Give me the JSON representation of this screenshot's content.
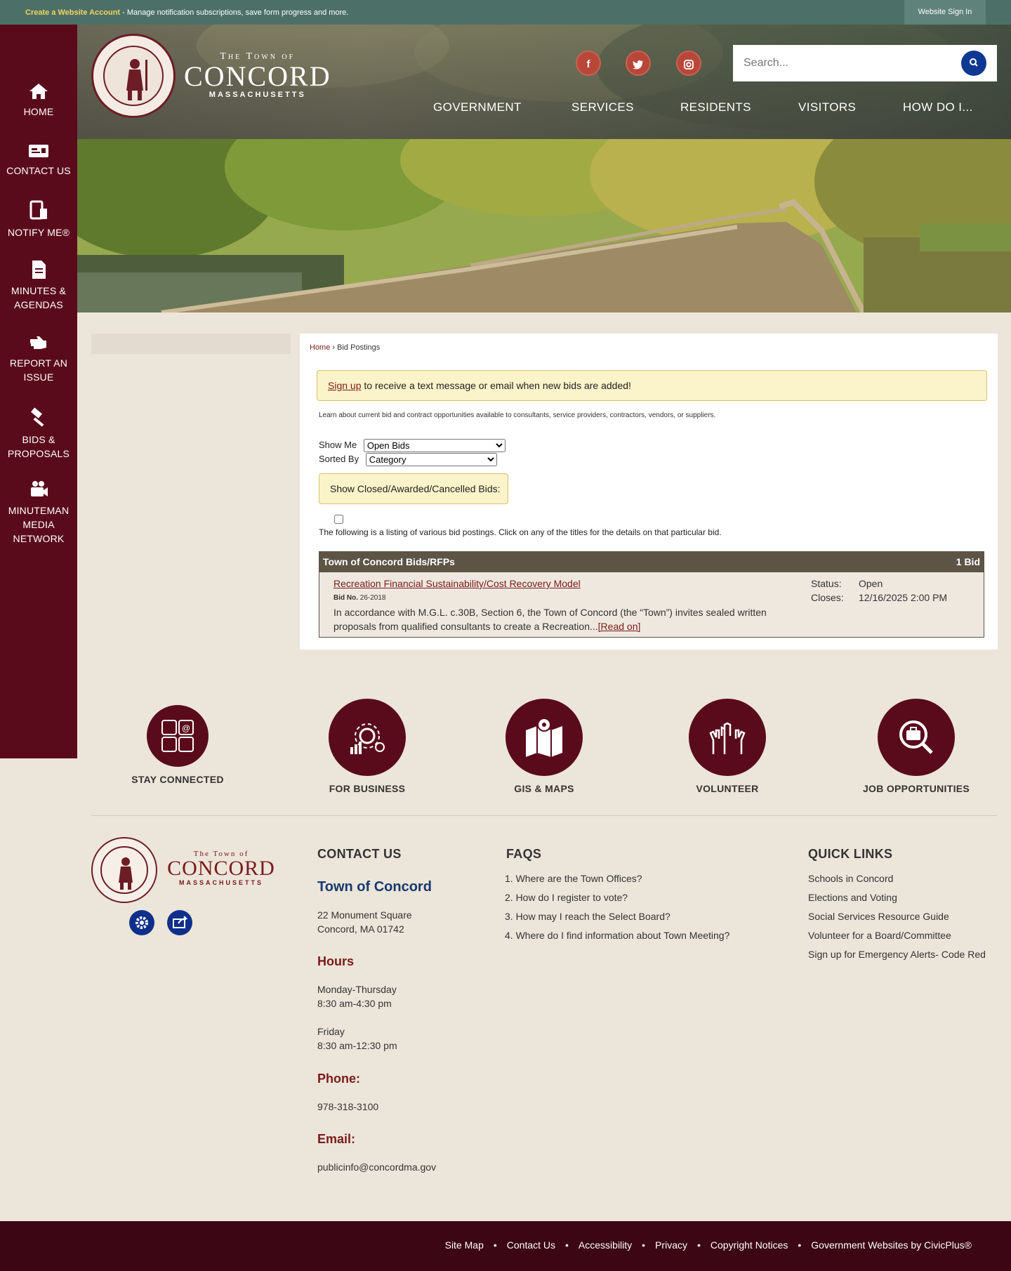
{
  "topbar": {
    "create_account": "Create a Website Account",
    "message": " - Manage notification subscriptions, save form progress and more.",
    "sign_in": "Website Sign In"
  },
  "sidebar": {
    "items": [
      {
        "label": "HOME",
        "icon": "home-icon"
      },
      {
        "label": "CONTACT US",
        "icon": "id-card-icon"
      },
      {
        "label": "NOTIFY ME®",
        "icon": "devices-icon"
      },
      {
        "label": "MINUTES &",
        "label2": "AGENDAS",
        "icon": "document-icon"
      },
      {
        "label": "REPORT AN",
        "label2": "ISSUE",
        "icon": "hand-icon"
      },
      {
        "label": "BIDS &",
        "label2": "PROPOSALS",
        "icon": "gavel-icon"
      },
      {
        "label": "MINUTEMAN",
        "label2": "MEDIA",
        "label3": "NETWORK",
        "icon": "video-camera-icon"
      }
    ]
  },
  "header": {
    "logo_line1": "The Town of",
    "logo_line2": "CONCORD",
    "logo_line3": "MASSACHUSETTS",
    "search_placeholder": "Search...",
    "social": [
      "f",
      "t",
      "ig"
    ],
    "nav": [
      "GOVERNMENT",
      "SERVICES",
      "RESIDENTS",
      "VISITORS",
      "HOW DO I..."
    ]
  },
  "breadcrumb": {
    "home": "Home",
    "sep": " › ",
    "current": "Bid Postings"
  },
  "alert": {
    "link": "Sign up",
    "text": " to receive a text message or email when new bids are added!"
  },
  "intro": "Learn about current bid and contract opportunities available to consultants, service providers, contractors, vendors, or suppliers.",
  "filters": {
    "show_me_label": "Show Me",
    "show_me_value": "Open Bids",
    "sorted_by_label": "Sorted By",
    "sorted_by_value": "Category",
    "closed_label": "Show Closed/Awarded/Cancelled Bids:"
  },
  "listing_text": "The following is a listing of various bid postings. Click on any of the titles for the details on that particular bid.",
  "bids": {
    "category": "Town of Concord Bids/RFPs",
    "count": "1 Bid",
    "items": [
      {
        "title": "Recreation Financial Sustainability/Cost Recovery Model",
        "bid_no_label": "Bid No.",
        "bid_no": "26-2018",
        "description": "In accordance with M.G.L. c.30B, Section 6, the Town of Concord (the “Town”) invites sealed written proposals from qualified consultants to create a Recreation...",
        "read_on": "[Read on]",
        "status_label": "Status:",
        "status": "Open",
        "closes_label": "Closes:",
        "closes": "12/16/2025 2:00 PM"
      }
    ]
  },
  "quick_icons": [
    {
      "label": "STAY CONNECTED",
      "icon": "contact-grid-icon"
    },
    {
      "label": "FOR BUSINESS",
      "icon": "business-gear-icon"
    },
    {
      "label": "GIS & MAPS",
      "icon": "map-pin-icon"
    },
    {
      "label": "VOLUNTEER",
      "icon": "raised-hands-icon"
    },
    {
      "label": "JOB OPPORTUNITIES",
      "icon": "briefcase-search-icon"
    }
  ],
  "footer": {
    "contact": {
      "heading": "CONTACT US",
      "org": "Town of Concord",
      "address1": "22 Monument Square",
      "address2": "Concord, MA 01742",
      "hours_heading": "Hours",
      "hours1_days": "Monday-Thursday",
      "hours1_time": "8:30 am-4:30 pm",
      "hours2_days": "Friday",
      "hours2_time": "8:30 am-12:30 pm",
      "phone_heading": "Phone:",
      "phone": "978-318-3100",
      "email_heading": "Email:",
      "email": "publicinfo@concordma.gov"
    },
    "faqs": {
      "heading": "FAQS",
      "items": [
        "1. Where are the Town Offices?",
        "2. How do I register to vote?",
        "3. How may I reach the Select Board?",
        "4. Where do I find information about Town Meeting?"
      ]
    },
    "quick_links": {
      "heading": "QUICK LINKS",
      "items": [
        "Schools in Concord",
        "Elections and Voting",
        "Social Services Resource Guide",
        "Volunteer for a Board/Committee",
        "Sign up for Emergency Alerts- Code Red"
      ]
    }
  },
  "bottom_links": [
    "Site Map",
    "Contact Us",
    "Accessibility",
    "Privacy",
    "Copyright Notices",
    "Government Websites by CivicPlus®"
  ],
  "colors": {
    "sidebar": "#5a0b1b",
    "accent": "#7a1a1a",
    "search_button": "#0f3893",
    "topbar": "#4c7068",
    "footer_bar": "#3c0614"
  }
}
